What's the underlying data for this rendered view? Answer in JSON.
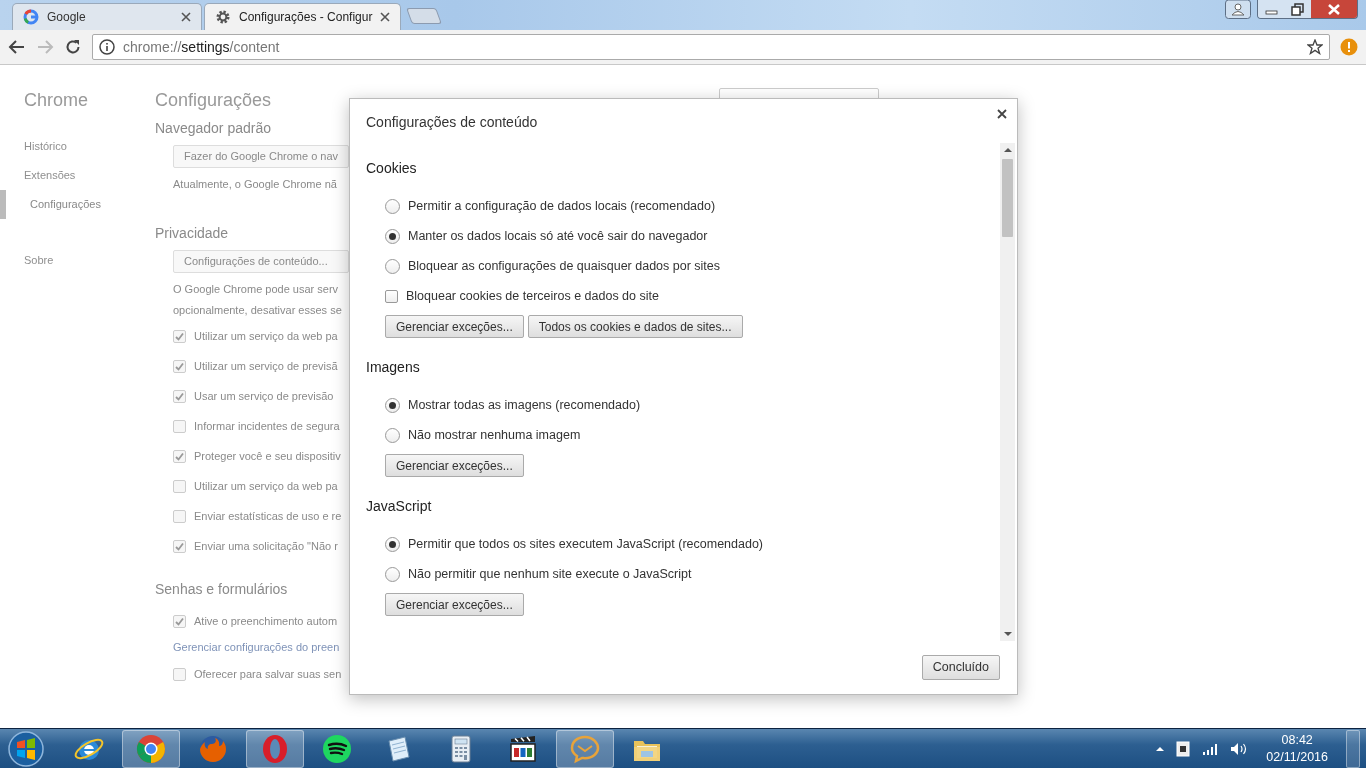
{
  "window": {
    "tabs": [
      {
        "label": "Google",
        "selected": false,
        "kind": "google"
      },
      {
        "label": "Configurações - Configur",
        "selected": true,
        "kind": "settings"
      }
    ]
  },
  "toolbar": {
    "address": {
      "scheme": "chrome://",
      "host": "settings",
      "path": "/content"
    }
  },
  "settings_page": {
    "sidebar": {
      "title": "Chrome",
      "items": [
        {
          "label": "Histórico",
          "selected": false
        },
        {
          "label": "Extensões",
          "selected": false
        },
        {
          "label": "Configurações",
          "selected": true
        },
        {
          "label": "Sobre",
          "selected": false
        }
      ]
    },
    "title": "Configurações",
    "sections": [
      {
        "heading": "Navegador padrão",
        "items": [
          {
            "kind": "button",
            "label": "Fazer do Google Chrome o nav"
          },
          {
            "kind": "note",
            "text": "Atualmente, o Google Chrome nã"
          }
        ]
      },
      {
        "heading": "Privacidade",
        "items": [
          {
            "kind": "button",
            "label": "Configurações de conteúdo..."
          },
          {
            "kind": "note",
            "text": "O Google Chrome pode usar serv"
          },
          {
            "kind": "note",
            "text": "opcionalmente, desativar esses se"
          },
          {
            "kind": "checkbox",
            "label": "Utilizar um serviço da web pa",
            "checked": true
          },
          {
            "kind": "checkbox",
            "label": "Utilizar um serviço de previsã",
            "checked": true
          },
          {
            "kind": "checkbox",
            "label": "Usar um serviço de previsão",
            "checked": true
          },
          {
            "kind": "checkbox",
            "label": "Informar incidentes de segura",
            "checked": false
          },
          {
            "kind": "checkbox",
            "label": "Proteger você e seu dispositiv",
            "checked": true
          },
          {
            "kind": "checkbox",
            "label": "Utilizar um serviço da web pa",
            "checked": false
          },
          {
            "kind": "checkbox",
            "label": "Enviar estatísticas de uso e re",
            "checked": false
          },
          {
            "kind": "checkbox",
            "label": "Enviar uma solicitação \"Não r",
            "checked": true
          }
        ]
      },
      {
        "heading": "Senhas e formulários",
        "items": [
          {
            "kind": "checkbox",
            "label": "Ative o preenchimento autom",
            "checked": true
          },
          {
            "kind": "link",
            "text": "Gerenciar configurações do preen"
          },
          {
            "kind": "checkbox",
            "label": "Oferecer para salvar suas sen",
            "checked": false
          }
        ]
      }
    ]
  },
  "dialog": {
    "title": "Configurações de conteúdo",
    "sections": [
      {
        "heading": "Cookies",
        "options": [
          {
            "kind": "radio",
            "label": "Permitir a configuração de dados locais (recomendado)",
            "selected": false
          },
          {
            "kind": "radio",
            "label": "Manter os dados locais só até você sair do navegador",
            "selected": true
          },
          {
            "kind": "radio",
            "label": "Bloquear as configurações de quaisquer dados por sites",
            "selected": false
          },
          {
            "kind": "checkbox",
            "label": "Bloquear cookies de terceiros e dados do site",
            "checked": false
          }
        ],
        "buttons": [
          "Gerenciar exceções...",
          "Todos os cookies e dados de sites..."
        ]
      },
      {
        "heading": "Imagens",
        "options": [
          {
            "kind": "radio",
            "label": "Mostrar todas as imagens (recomendado)",
            "selected": true
          },
          {
            "kind": "radio",
            "label": "Não mostrar nenhuma imagem",
            "selected": false
          }
        ],
        "buttons": [
          "Gerenciar exceções..."
        ]
      },
      {
        "heading": "JavaScript",
        "options": [
          {
            "kind": "radio",
            "label": "Permitir que todos os sites executem JavaScript (recomendado)",
            "selected": true
          },
          {
            "kind": "radio",
            "label": "Não permitir que nenhum site execute o JavaScript",
            "selected": false
          }
        ],
        "buttons": [
          "Gerenciar exceções..."
        ]
      }
    ],
    "done_button": "Concluído"
  },
  "taskbar": {
    "apps": [
      {
        "kind": "ie",
        "open": false
      },
      {
        "kind": "chrome",
        "open": true
      },
      {
        "kind": "firefox",
        "open": false
      },
      {
        "kind": "opera",
        "open": true
      },
      {
        "kind": "spotify",
        "open": false
      },
      {
        "kind": "notepad",
        "open": false
      },
      {
        "kind": "calculator",
        "open": false
      },
      {
        "kind": "media",
        "open": false
      },
      {
        "kind": "mail",
        "open": true
      },
      {
        "kind": "folder",
        "open": false
      }
    ],
    "clock": {
      "time": "08:42",
      "date": "02/11/2016"
    }
  }
}
